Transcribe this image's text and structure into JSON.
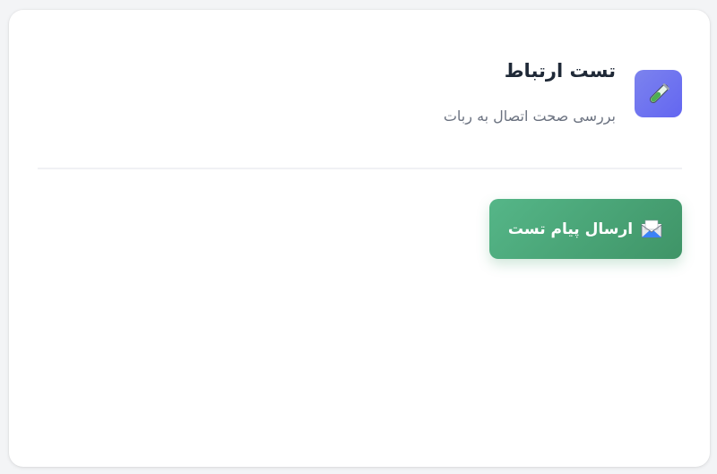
{
  "card": {
    "title": "تست ارتباط",
    "subtitle": "بررسی صحت اتصال به ربات",
    "icon": "test-tube-icon"
  },
  "actions": {
    "send_test_label": "ارسال پیام تست",
    "send_test_icon": "envelope-icon"
  },
  "colors": {
    "icon_bg": "#6f75ef",
    "button_bg": "#4ba77a",
    "title_text": "#1f2937",
    "subtitle_text": "#6b7280"
  }
}
